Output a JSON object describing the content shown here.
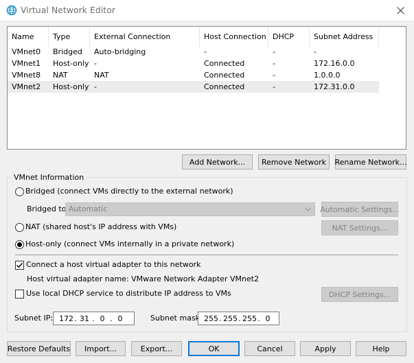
{
  "window": {
    "title": "Virtual Network Editor"
  },
  "network_list": {
    "columns": [
      "Name",
      "Type",
      "External Connection",
      "Host Connection",
      "DHCP",
      "Subnet Address"
    ],
    "rows": [
      {
        "name": "VMnet0",
        "type": "Bridged",
        "external": "Auto-bridging",
        "host": "-",
        "dhcp": "-",
        "subnet": "-"
      },
      {
        "name": "VMnet1",
        "type": "Host-only",
        "external": "-",
        "host": "Connected",
        "dhcp": "-",
        "subnet": "172.16.0.0"
      },
      {
        "name": "VMnet8",
        "type": "NAT",
        "external": "NAT",
        "host": "Connected",
        "dhcp": "-",
        "subnet": "1.0.0.0"
      },
      {
        "name": "VMnet2",
        "type": "Host-only",
        "external": "-",
        "host": "Connected",
        "dhcp": "-",
        "subnet": "172.31.0.0"
      }
    ],
    "selected_row": 3
  },
  "list_buttons": {
    "add": "Add Network...",
    "remove": "Remove Network",
    "rename": "Rename Network..."
  },
  "vmnet_info": {
    "group_label": "VMnet Information",
    "bridged_label": "Bridged (connect VMs directly to the external network)",
    "bridged_to_label": "Bridged to:",
    "bridged_to_value": "Automatic",
    "auto_settings": "Automatic Settings...",
    "nat_label": "NAT (shared host's IP address with VMs)",
    "nat_settings": "NAT Settings...",
    "hostonly_label": "Host-only (connect VMs internally in a private network)",
    "selected_mode": "host-only",
    "connect_adapter_label": "Connect a host virtual adapter to this network",
    "connect_adapter_checked": true,
    "adapter_name_label": "Host virtual adapter name: VMware Network Adapter VMnet2",
    "dhcp_label": "Use local DHCP service to distribute IP address to VMs",
    "dhcp_checked": false,
    "dhcp_settings": "DHCP Settings...",
    "subnet_ip_label": "Subnet IP:",
    "subnet_ip": [
      "172",
      "31",
      "0",
      "0"
    ],
    "subnet_mask_label": "Subnet mask:",
    "subnet_mask": [
      "255",
      "255",
      "255",
      "0"
    ]
  },
  "footer_buttons": {
    "restore": "Restore Defaults",
    "import": "Import...",
    "export": "Export...",
    "ok": "OK",
    "cancel": "Cancel",
    "apply": "Apply",
    "help": "Help"
  },
  "colors": {
    "accent": "#0078d7",
    "title_icon": "#1e88c7",
    "selection": "#ececec"
  }
}
